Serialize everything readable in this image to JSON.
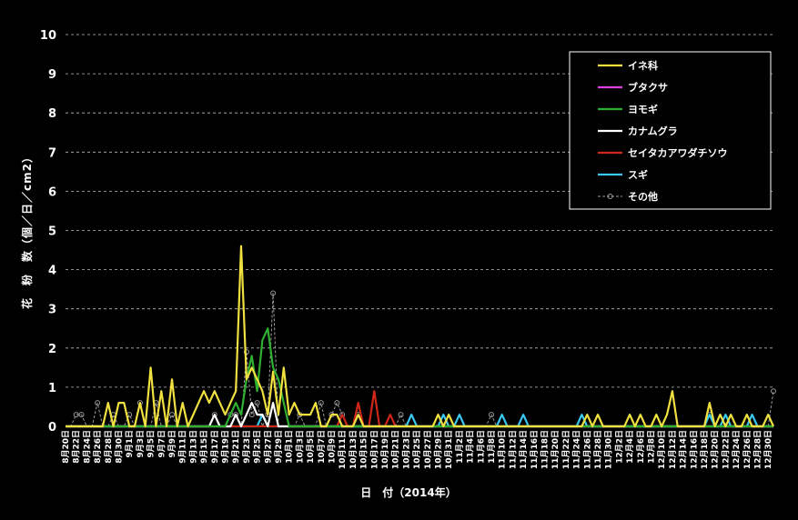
{
  "chart_data": {
    "type": "line",
    "title": "",
    "xlabel": "日　付（2014年）",
    "ylabel": "花　粉　数（個／日／cm2）",
    "ylim": [
      0,
      10
    ],
    "yticks": [
      "0",
      "1",
      "2",
      "3",
      "4",
      "5",
      "6",
      "7",
      "8",
      "9",
      "10"
    ],
    "grid": true,
    "legend_position": "top-right",
    "xtick_labels": [
      "8月20日",
      "8月22日",
      "8月24日",
      "8月26日",
      "8月28日",
      "8月30日",
      "9月1日",
      "9月3日",
      "9月5日",
      "9月7日",
      "9月9日",
      "9月11日",
      "9月13日",
      "9月15日",
      "9月17日",
      "9月19日",
      "9月21日",
      "9月23日",
      "9月25日",
      "9月27日",
      "9月29日",
      "10月1日",
      "10月3日",
      "10月5日",
      "10月7日",
      "10月9日",
      "10月11日",
      "10月13日",
      "10月15日",
      "10月17日",
      "10月19日",
      "10月21日",
      "10月23日",
      "10月25日",
      "10月27日",
      "10月29日",
      "10月31日",
      "11月2日",
      "11月4日",
      "11月6日",
      "11月8日",
      "11月10日",
      "11月12日",
      "11月14日",
      "11月16日",
      "11月18日",
      "11月20日",
      "11月22日",
      "11月24日",
      "11月26日",
      "11月28日",
      "11月30日",
      "12月2日",
      "12月4日",
      "12月6日",
      "12月8日",
      "12月10日",
      "12月12日",
      "12月14日",
      "12月16日",
      "12月18日",
      "12月20日",
      "12月22日",
      "12月24日",
      "12月26日",
      "12月28日",
      "12月30日"
    ],
    "series": [
      {
        "name": "イネ科",
        "color": "#f0e040",
        "style": "solid",
        "values": {
          "8": 0.6,
          "10": 0.6,
          "11": 0.6,
          "14": 0.6,
          "16": 1.5,
          "18": 0.9,
          "20": 1.2,
          "22": 0.6,
          "24": 0.3,
          "25": 0.6,
          "26": 0.9,
          "27": 0.6,
          "28": 0.9,
          "29": 0.6,
          "30": 0.3,
          "31": 0.6,
          "32": 0.9,
          "33": 4.6,
          "34": 1.2,
          "35": 1.5,
          "36": 1.2,
          "37": 0.9,
          "38": 0.3,
          "39": 1.4,
          "40": 0.3,
          "41": 1.5,
          "42": 0.3,
          "43": 0.6,
          "44": 0.3,
          "45": 0.3,
          "46": 0.3,
          "47": 0.6,
          "50": 0.3,
          "51": 0.3,
          "55": 0.3,
          "70": 0.3,
          "72": 0.3,
          "98": 0.3,
          "100": 0.3,
          "106": 0.3,
          "108": 0.3,
          "111": 0.3,
          "113": 0.3,
          "114": 0.9,
          "121": 0.6,
          "123": 0.3,
          "125": 0.3,
          "128": 0.3,
          "132": 0.3
        }
      },
      {
        "name": "ブタクサ",
        "color": "#e040e0",
        "style": "solid",
        "values": {}
      },
      {
        "name": "ヨモギ",
        "color": "#30b030",
        "style": "solid",
        "values": {
          "31": 0.3,
          "32": 0.6,
          "33": 0.3,
          "34": 1.2,
          "35": 1.8,
          "36": 0.9,
          "37": 2.2,
          "38": 2.5,
          "39": 1.5,
          "40": 1.2,
          "41": 0.6
        }
      },
      {
        "name": "カナムグラ",
        "color": "#ffffff",
        "style": "solid",
        "values": {
          "28": 0.3,
          "32": 0.3,
          "34": 0.3,
          "35": 0.6,
          "36": 0.3,
          "37": 0.3,
          "39": 0.6
        }
      },
      {
        "name": "セイタカアワダチソウ",
        "color": "#d02818",
        "style": "solid",
        "values": {
          "52": 0.3,
          "55": 0.6,
          "58": 0.9,
          "61": 0.3
        }
      },
      {
        "name": "スギ",
        "color": "#38c8f0",
        "style": "solid",
        "values": {
          "37": 0.3,
          "65": 0.3,
          "71": 0.3,
          "74": 0.3,
          "82": 0.3,
          "86": 0.3,
          "97": 0.3,
          "121": 0.3,
          "124": 0.3,
          "129": 0.3
        }
      },
      {
        "name": "その他",
        "color": "#9a9a9a",
        "style": "dashed",
        "values": {
          "2": 0.3,
          "3": 0.3,
          "6": 0.6,
          "9": 0.3,
          "12": 0.3,
          "14": 0.6,
          "17": 0.6,
          "20": 0.3,
          "28": 0.3,
          "31": 0.3,
          "32": 0.3,
          "34": 1.9,
          "35": 0.3,
          "36": 0.6,
          "38": 0.3,
          "39": 3.4,
          "44": 0.3,
          "48": 0.6,
          "50": 0.3,
          "51": 0.6,
          "52": 0.3,
          "55": 0.3,
          "63": 0.3,
          "80": 0.3,
          "121": 0.3,
          "133": 0.9
        }
      }
    ]
  }
}
